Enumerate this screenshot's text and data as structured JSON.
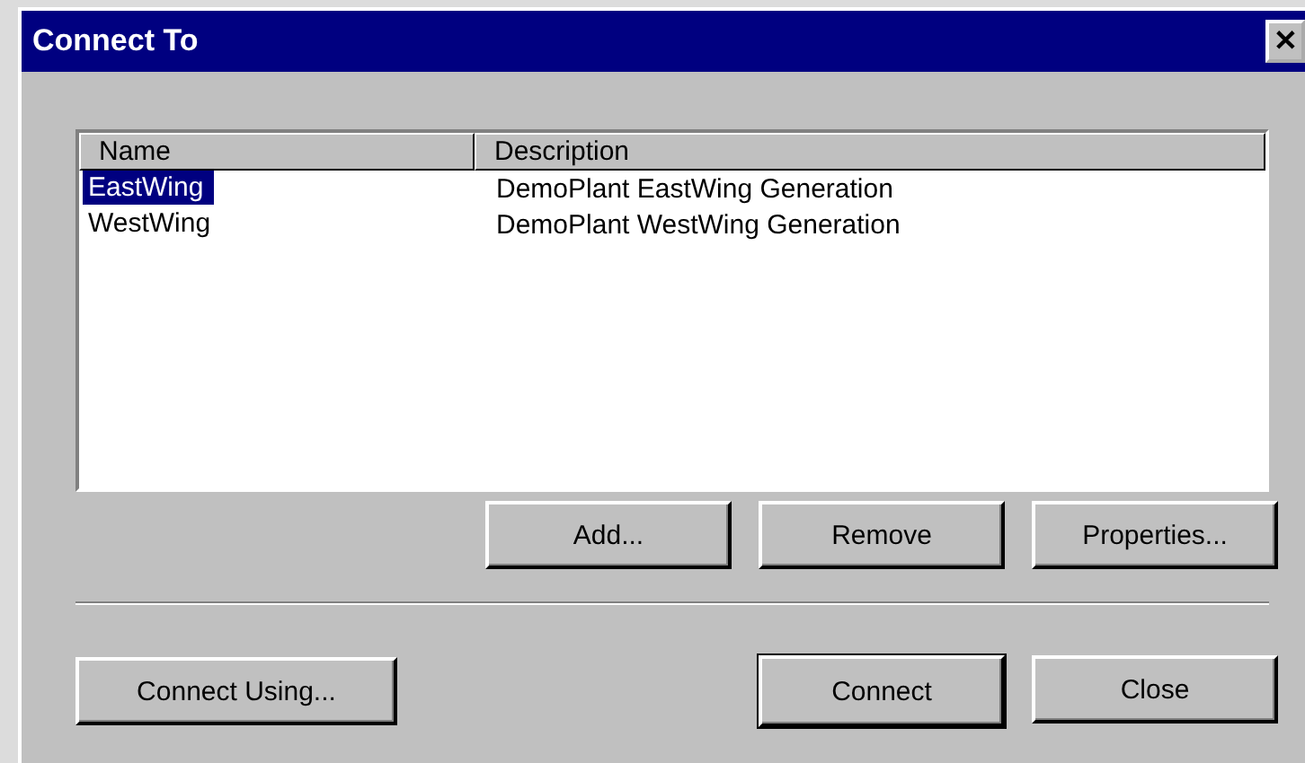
{
  "window": {
    "title": "Connect To",
    "close_glyph": "✕"
  },
  "list": {
    "columns": [
      "Name",
      "Description"
    ],
    "rows": [
      {
        "name": "EastWing",
        "description": "DemoPlant EastWing Generation",
        "selected": true
      },
      {
        "name": "WestWing",
        "description": "DemoPlant WestWing Generation",
        "selected": false
      }
    ]
  },
  "list_buttons": [
    {
      "label": "Add...",
      "default": false
    },
    {
      "label": "Remove",
      "default": false
    },
    {
      "label": "Properties...",
      "default": false
    }
  ],
  "footer": {
    "left_button": {
      "label": "Connect Using...",
      "default": false
    },
    "right_buttons": [
      {
        "label": "Connect",
        "default": true
      },
      {
        "label": "Close",
        "default": false
      }
    ]
  }
}
